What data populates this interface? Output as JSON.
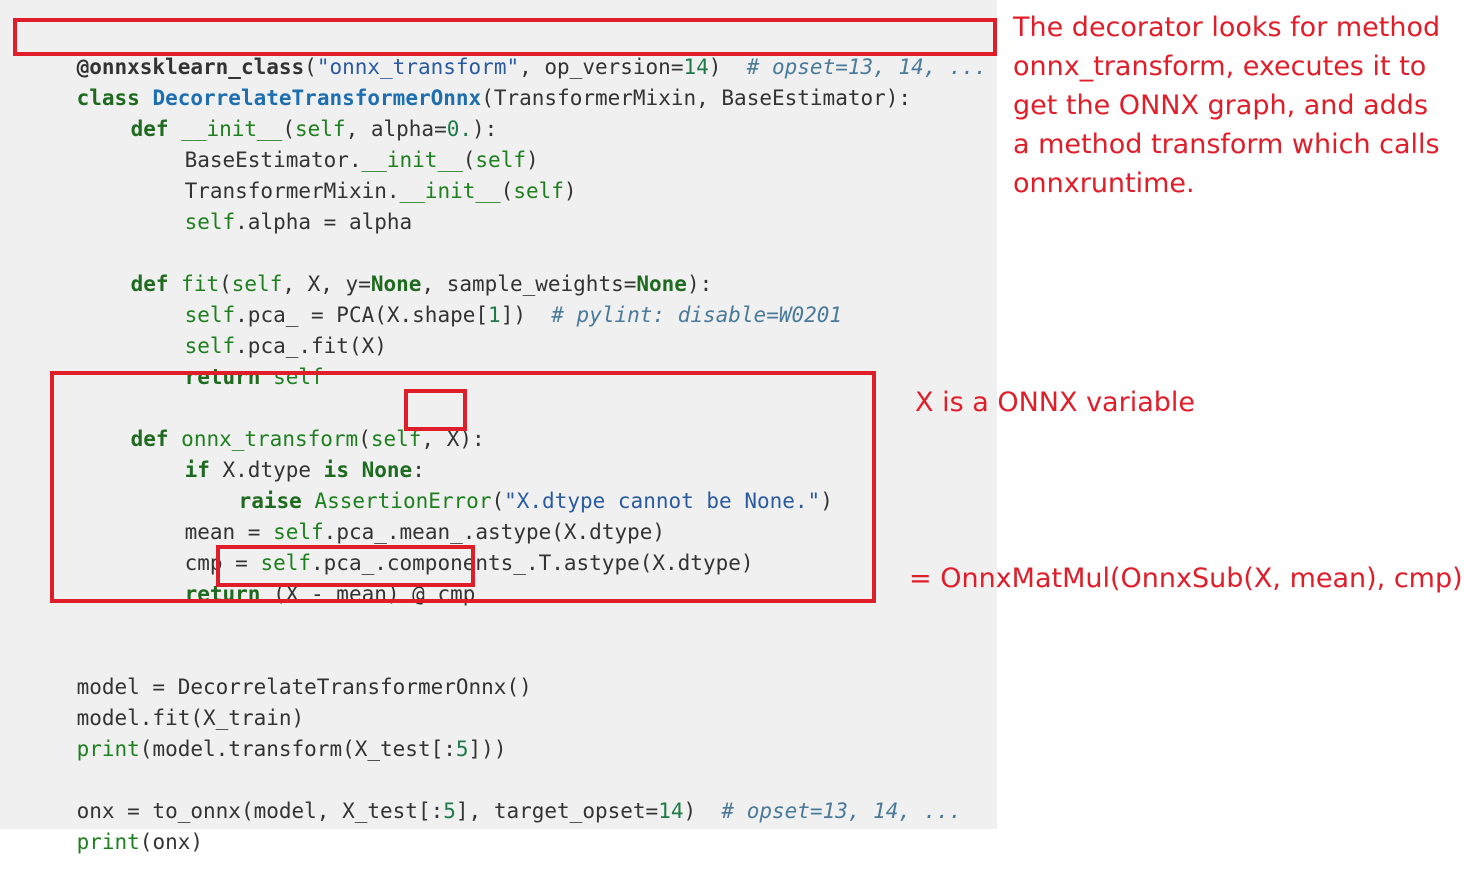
{
  "code": {
    "decorator": {
      "name": "@onnxsklearn_class",
      "open": "(",
      "arg": "\"onnx_transform\"",
      "sep": ", op_version=",
      "ver": "14",
      "close": ")  ",
      "comment": "# opset=13, 14, ..."
    },
    "class_line": {
      "kw": "class",
      "name": "DecorrelateTransformerOnnx",
      "rest": "(TransformerMixin, BaseEstimator):"
    },
    "init_def": {
      "kw": "def",
      "name": "__init__",
      "open": "(",
      "self": "self",
      "rest": ", alpha=",
      "num": "0.",
      "close": "):"
    },
    "init_body1": {
      "pre": "BaseEstimator.",
      "name": "__init__",
      "open": "(",
      "self": "self",
      "close": ")"
    },
    "init_body2": {
      "pre": "TransformerMixin.",
      "name": "__init__",
      "open": "(",
      "self": "self",
      "close": ")"
    },
    "init_body3": {
      "self": "self",
      "rest": ".alpha = alpha"
    },
    "fit_def": {
      "kw": "def",
      "name": "fit",
      "open": "(",
      "self": "self",
      "p1": ", X, y=",
      "none1": "None",
      "p2": ", sample_weights=",
      "none2": "None",
      "close": "):"
    },
    "fit_body1": {
      "self": "self",
      "rest1": ".pca_ = PCA(X.shape[",
      "num": "1",
      "rest2": "])  ",
      "comment": "# pylint: disable=W0201"
    },
    "fit_body2": {
      "self": "self",
      "rest": ".pca_.fit(X)"
    },
    "fit_body3": {
      "kw": "return",
      "self": " self"
    },
    "onnx_def": {
      "kw": "def",
      "name": "onnx_transform",
      "open": "(",
      "self": "self",
      "rest": ", X):"
    },
    "onnx_if": {
      "kw": "if",
      "mid": " X.dtype ",
      "kw2": "is",
      "sp": " ",
      "none": "None",
      "end": ":"
    },
    "onnx_raise": {
      "kw": "raise",
      "sp": " ",
      "exc": "AssertionError",
      "open": "(",
      "str": "\"X.dtype cannot be None.\"",
      "close": ")"
    },
    "onnx_mean": {
      "pre": "mean = ",
      "self": "self",
      "rest": ".pca_.mean_.astype(X.dtype)"
    },
    "onnx_cmp": {
      "pre": "cmp = ",
      "self": "self",
      "rest": ".pca_.components_.T.astype(X.dtype)"
    },
    "onnx_return": {
      "kw": "return",
      "rest": " (X - mean) @ cmp"
    },
    "model_line": {
      "text": "model = DecorrelateTransformerOnnx()"
    },
    "fit_call": {
      "text": "model.fit(X_train)"
    },
    "print1": {
      "fn": "print",
      "rest1": "(model.transform(X_test[:",
      "num": "5",
      "rest2": "]))"
    },
    "onx_line": {
      "rest1": "onx = to_onnx(model, X_test[:",
      "num1": "5",
      "rest2": "], target_opset=",
      "num2": "14",
      "rest3": ")  ",
      "comment": "# opset=13, 14, ..."
    },
    "print2": {
      "fn": "print",
      "rest": "(onx)"
    }
  },
  "annotations": {
    "decorator_note": "The decorator looks for method onnx_transform, executes it to get the ONNX graph, and adds a method transform which calls onnxruntime.",
    "variable_note": "X is a ONNX variable",
    "matmul_note": "= OnnxMatMul(OnnxSub(X, mean), cmp)"
  },
  "colors": {
    "highlight": "#e01e2a",
    "code_background": "#f0f0f0"
  }
}
